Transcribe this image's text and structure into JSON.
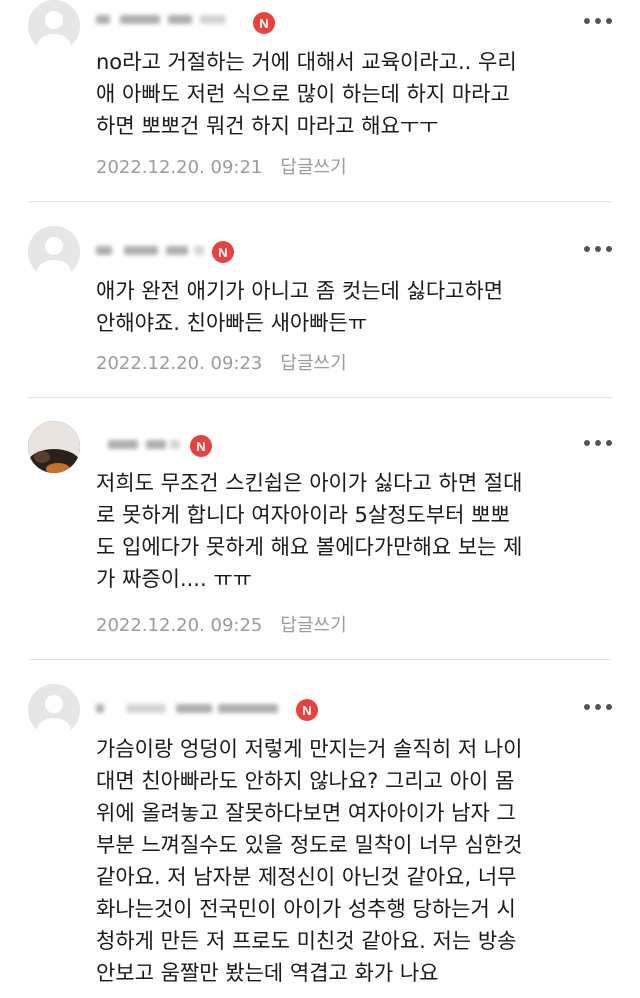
{
  "comments": [
    {
      "badge": "N",
      "text": "no라고 거절하는 거에 대해서 교육이라고.. 우리\n애 아빠도 저런 식으로 많이 하는데 하지 마라고\n하면 뽀뽀건 뭐건 하지 마라고 해요ㅜㅜ",
      "date": "2022.12.20. 09:21",
      "reply_label": "답글쓰기"
    },
    {
      "badge": "N",
      "text": "애가 완전 애기가 아니고 좀 컷는데 싫다고하면\n안해야죠. 친아빠든 새아빠든ㅠ",
      "date": "2022.12.20. 09:23",
      "reply_label": "답글쓰기"
    },
    {
      "badge": "N",
      "text": "저희도 무조건 스킨쉽은 아이가 싫다고 하면 절대\n로 못하게 합니다 여자아이라 5살정도부터 뽀뽀\n도 입에다가 못하게 해요 볼에다가만해요 보는 제\n가 짜증이.... ㅠㅠ",
      "date": "2022.12.20. 09:25",
      "reply_label": "답글쓰기"
    },
    {
      "badge": "N",
      "text": "가슴이랑 엉덩이 저렇게 만지는거 솔직히 저 나이\n대면 친아빠라도 안하지 않나요? 그리고 아이 몸\n위에 올려놓고 잘못하다보면 여자아이가 남자 그\n부분 느껴질수도 있을 정도로 밀착이 너무 심한것\n같아요. 저 남자분 제정신이 아닌것 같아요, 너무\n화나는것이 전국민이 아이가 성추행 당하는거 시\n청하게 만든 저 프로도 미친것 같아요. 저는 방송\n안보고 움짤만 봤는데 역겹고 화가 나요"
    }
  ],
  "icons": {
    "avatar": "default-avatar-icon",
    "more": "more-options-icon",
    "badge": "new-badge-icon"
  },
  "colors": {
    "badge": "#e8413e",
    "meta": "#9b9b9b",
    "text": "#1a1a1a",
    "divider": "#e2e2e2"
  }
}
